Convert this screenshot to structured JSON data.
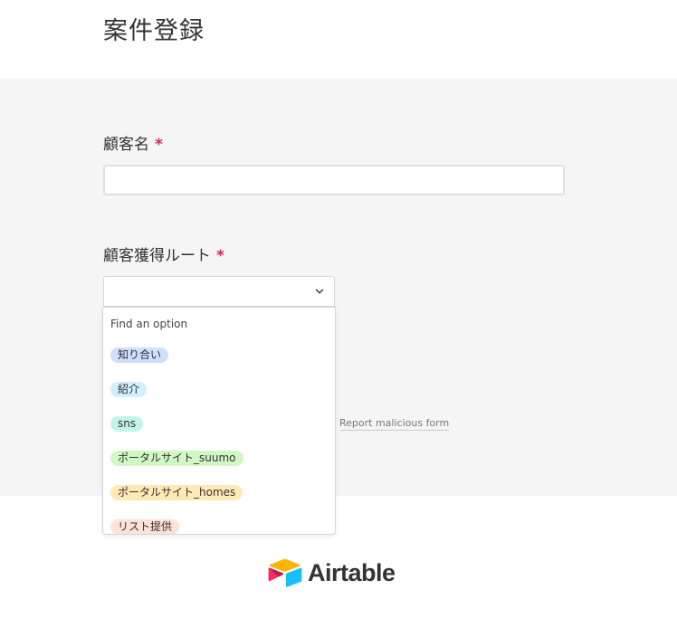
{
  "form": {
    "title": "案件登録",
    "required_mark": "*"
  },
  "fields": {
    "customer_name": {
      "label": "顧客名",
      "value": ""
    },
    "acquisition_route": {
      "label": "顧客獲得ルート",
      "value": ""
    }
  },
  "dropdown": {
    "search_placeholder": "Find an option",
    "options": [
      {
        "label": "知り合い",
        "color": "#cfdfff"
      },
      {
        "label": "紹介",
        "color": "#d0f0fd"
      },
      {
        "label": "sns",
        "color": "#c2f5e9"
      },
      {
        "label": "ポータルサイト_suumo",
        "color": "#d1f7c4"
      },
      {
        "label": "ポータルサイト_homes",
        "color": "#ffeab6"
      },
      {
        "label": "リスト提供",
        "color": "#fee2d5"
      }
    ]
  },
  "footer": {
    "report_link": "Report malicious form",
    "brand": "Airtable"
  },
  "icons": {
    "select_chevron": "chevron-down-icon",
    "brand_logo": "airtable-logo-icon"
  }
}
